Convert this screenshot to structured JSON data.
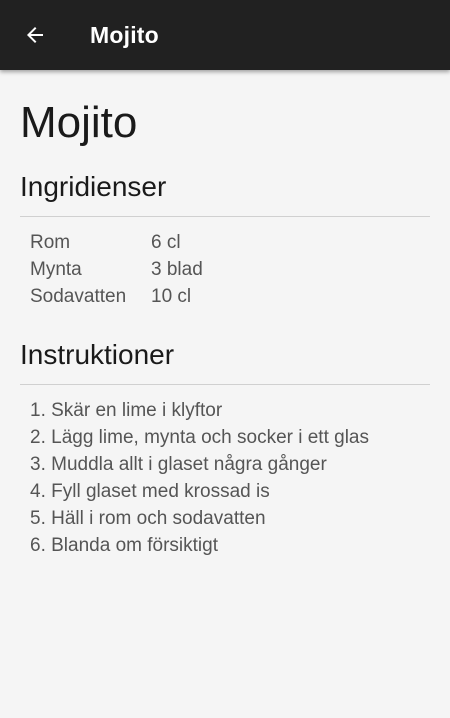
{
  "appbar": {
    "title": "Mojito",
    "back_icon": "arrow-left-icon",
    "background": "#212121"
  },
  "recipe": {
    "title": "Mojito",
    "ingredients_heading": "Ingridienser",
    "ingredients": [
      {
        "name": "Rom",
        "amount": "6 cl"
      },
      {
        "name": "Mynta",
        "amount": "3 blad"
      },
      {
        "name": "Sodavatten",
        "amount": "10 cl"
      }
    ],
    "instructions_heading": "Instruktioner",
    "instructions": [
      "1. Skär en lime i klyftor",
      "2. Lägg lime, mynta och socker i ett glas",
      "3. Muddla allt i glaset några gånger",
      "4. Fyll glaset med krossad is",
      "5. Häll i rom och sodavatten",
      "6. Blanda om försiktigt"
    ]
  }
}
